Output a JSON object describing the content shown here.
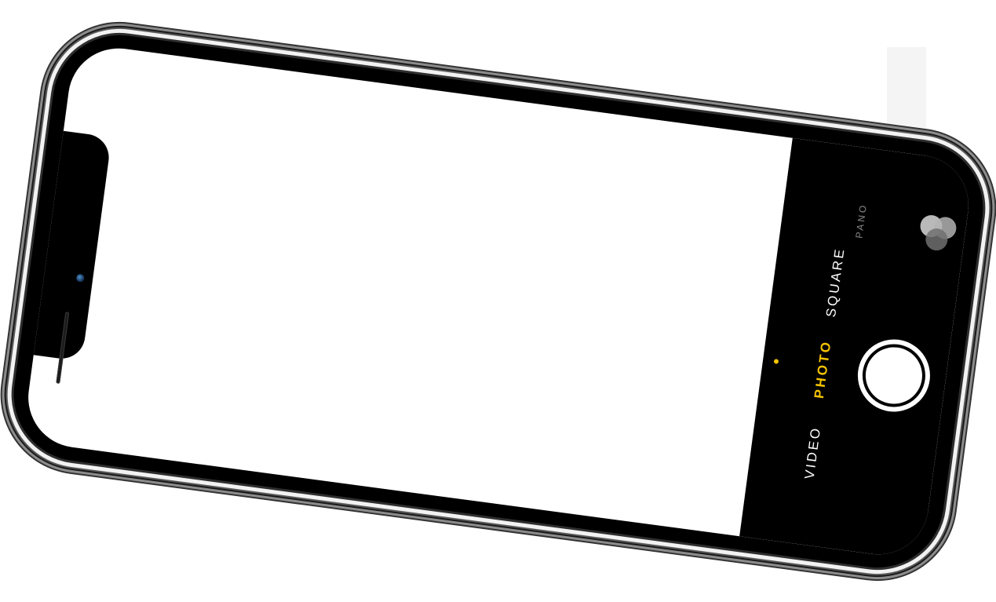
{
  "camera_app": {
    "modes": {
      "pano": "PANO",
      "square": "SQUARE",
      "photo": "PHOTO",
      "video": "VIDEO"
    },
    "active_mode": "PHOTO",
    "active_mode_color": "#f5c400",
    "shutter_icon": "shutter-button",
    "filters_icon": "filters-icon"
  },
  "device": {
    "frame_color": "#000000",
    "screen_color": "#ffffff"
  }
}
